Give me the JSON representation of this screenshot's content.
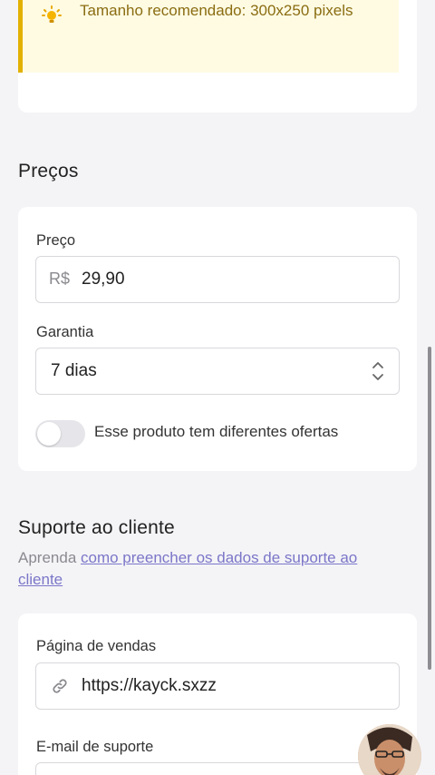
{
  "image_tip": {
    "text": "Tamanho recomendado: 300x250 pixels",
    "icon": "lightbulb-icon"
  },
  "pricing": {
    "section_title": "Preços",
    "price_label": "Preço",
    "currency_prefix": "R$",
    "price_value": "29,90",
    "warranty_label": "Garantia",
    "warranty_value": "7 dias",
    "offers_toggle_label": "Esse produto tem diferentes ofertas",
    "offers_toggle_on": false
  },
  "support": {
    "section_title": "Suporte ao cliente",
    "desc_prefix": "Aprenda ",
    "desc_link": "como preencher os dados de suporte ao cliente",
    "sales_page_label": "Página de vendas",
    "sales_page_value": "https://kayck.sxzz",
    "email_label": "E-mail de suporte"
  },
  "colors": {
    "accent_link": "#7b76c8",
    "tip_border": "#e2b100",
    "tip_background": "#fffbe3"
  }
}
